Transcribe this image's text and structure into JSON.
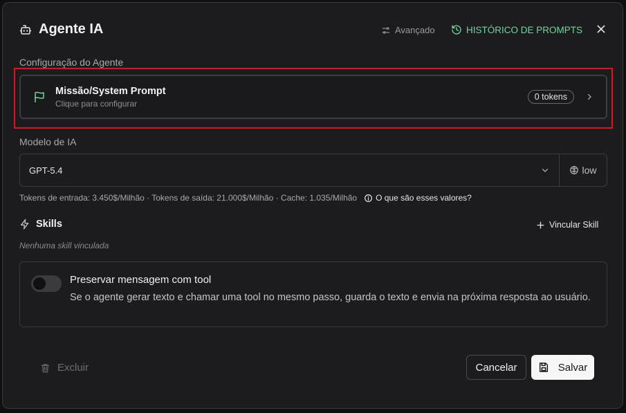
{
  "header": {
    "title": "Agente IA",
    "advanced_label": "Avançado",
    "history_label": "HISTÓRICO DE PROMPTS"
  },
  "config": {
    "section_label": "Configuração do Agente",
    "prompt_title": "Missão/System Prompt",
    "prompt_subtitle": "Clique para configurar",
    "tokens_badge": "0 tokens"
  },
  "model": {
    "section_label": "Modelo de IA",
    "selected": "GPT-5.4",
    "effort": "low",
    "pricing_text": "Tokens de entrada: 3.450$/Milhão · Tokens de saída: 21.000$/Milhão · Cache: 1.035/Milhão",
    "pricing_info": "O que são esses valores?"
  },
  "skills": {
    "title": "Skills",
    "link_label": "Vincular Skill",
    "empty_text": "Nenhuma skill vinculada"
  },
  "tool_option": {
    "title": "Preservar mensagem com tool",
    "description": "Se o agente gerar texto e chamar uma tool no mesmo passo, guarda o texto e envia na próxima resposta ao usuário.",
    "enabled": false
  },
  "footer": {
    "delete_label": "Excluir",
    "cancel_label": "Cancelar",
    "save_label": "Salvar"
  },
  "colors": {
    "accent_green": "#6fd89a",
    "highlight_red": "#e0141b",
    "background": "#1c1c1e"
  },
  "icons": [
    "robot-icon",
    "sliders-icon",
    "history-icon",
    "close-icon",
    "flag-icon",
    "chevron-right-icon",
    "chevron-down-icon",
    "brain-icon",
    "info-icon",
    "bolt-icon",
    "plus-icon",
    "trash-icon",
    "save-icon"
  ]
}
